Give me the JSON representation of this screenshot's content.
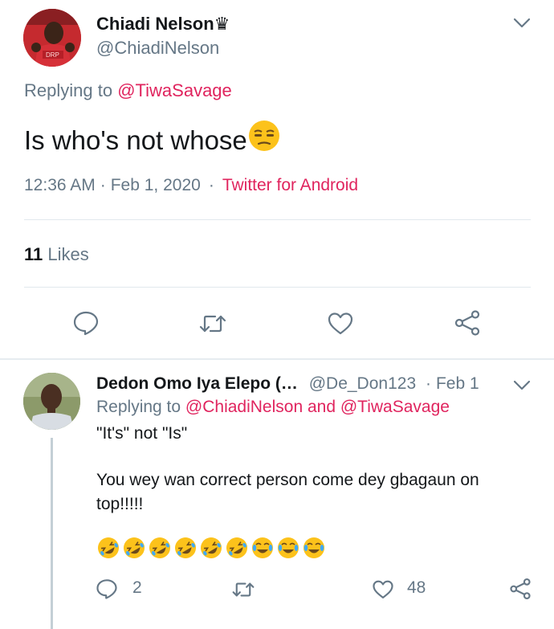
{
  "main_tweet": {
    "author_name": "Chiadi Nelson♛",
    "author_handle": "@ChiadiNelson",
    "replying_prefix": "Replying to ",
    "replying_to": "@TiwaSavage",
    "text": "Is who's not whose",
    "emoji": "unamused-face-emoji",
    "time": "12:36 AM",
    "date": "Feb 1, 2020",
    "source": "Twitter for Android",
    "likes_count": "11",
    "likes_label": "Likes",
    "actions": [
      "reply-icon",
      "retweet-icon",
      "like-icon",
      "share-icon"
    ]
  },
  "reply_tweet": {
    "author_name": "Dedon Omo Iya Elepo (…",
    "author_handle": "@De_Don123",
    "date": "Feb 1",
    "replying_prefix": "Replying to ",
    "replying_to_1": "@ChiadiNelson",
    "replying_and": " and ",
    "replying_to_2": "@TiwaSavage",
    "line1": "\"It's\" not \"Is\"",
    "line2": "You wey wan correct person come dey gbagaun on",
    "line3": "top!!!!!",
    "emojis": [
      "rofl",
      "rofl",
      "rofl",
      "rofl",
      "rofl",
      "rofl",
      "joy",
      "joy",
      "joy"
    ],
    "reply_count": "2",
    "retweet_count": "",
    "like_count": "48"
  },
  "colors": {
    "link": "#e0245e",
    "secondary_text": "#657786",
    "primary_text": "#14171a",
    "divider": "#e1e8ed",
    "icon": "#657786"
  }
}
